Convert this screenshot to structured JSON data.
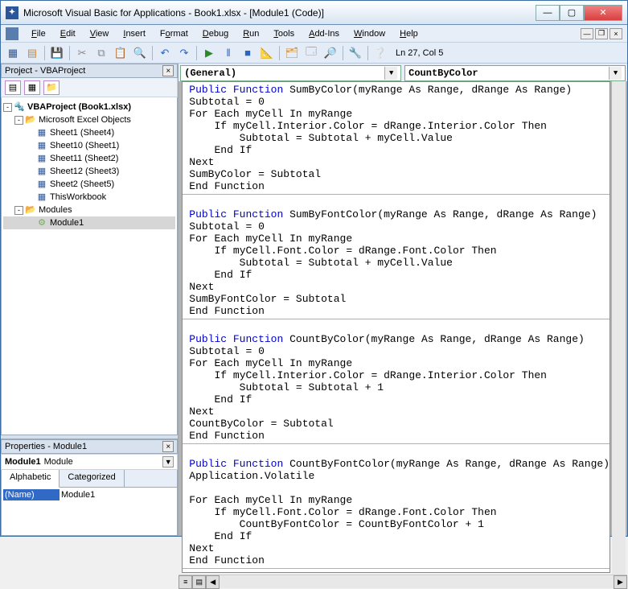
{
  "titlebar": {
    "text": "Microsoft Visual Basic for Applications - Book1.xlsx - [Module1 (Code)]"
  },
  "menubar": {
    "items": [
      {
        "label": "File",
        "accel": "F"
      },
      {
        "label": "Edit",
        "accel": "E"
      },
      {
        "label": "View",
        "accel": "V"
      },
      {
        "label": "Insert",
        "accel": "I"
      },
      {
        "label": "Format",
        "accel": "o"
      },
      {
        "label": "Debug",
        "accel": "D"
      },
      {
        "label": "Run",
        "accel": "R"
      },
      {
        "label": "Tools",
        "accel": "T"
      },
      {
        "label": "Add-Ins",
        "accel": "A"
      },
      {
        "label": "Window",
        "accel": "W"
      },
      {
        "label": "Help",
        "accel": "H"
      }
    ]
  },
  "toolbar": {
    "status": "Ln 27, Col 5"
  },
  "project_panel": {
    "title": "Project - VBAProject",
    "root": "VBAProject (Book1.xlsx)",
    "excel_folder": "Microsoft Excel Objects",
    "sheets": [
      "Sheet1 (Sheet4)",
      "Sheet10 (Sheet1)",
      "Sheet11 (Sheet2)",
      "Sheet12 (Sheet3)",
      "Sheet2 (Sheet5)"
    ],
    "workbook": "ThisWorkbook",
    "modules_folder": "Modules",
    "modules": [
      "Module1"
    ]
  },
  "properties_panel": {
    "title": "Properties - Module1",
    "object_bold": "Module1",
    "object_type": "Module",
    "tabs": [
      "Alphabetic",
      "Categorized"
    ],
    "rows": [
      {
        "name": "(Name)",
        "value": "Module1"
      }
    ]
  },
  "code_header": {
    "left_combo": "(General)",
    "right_combo": "CountByColor"
  },
  "code": {
    "functions": [
      {
        "lines": [
          {
            "t": "decl",
            "sig": "SumByColor",
            "params": "(myRange <kw>As</kw> Range, dRange <kw>As</kw> Range)"
          },
          {
            "t": "plain",
            "txt": "Subtotal = 0"
          },
          {
            "t": "for",
            "txt": "<kw>For Each</kw> myCell <kw>In</kw> myRange"
          },
          {
            "t": "if",
            "txt": "    <kw>If</kw> myCell.Interior.Color = dRange.Interior.Color <kw>Then</kw>"
          },
          {
            "t": "plain",
            "txt": "        Subtotal = Subtotal + myCell.Value"
          },
          {
            "t": "endif",
            "txt": "    <kw>End If</kw>"
          },
          {
            "t": "next",
            "txt": "<kw>Next</kw>"
          },
          {
            "t": "plain",
            "txt": "SumByColor = Subtotal"
          },
          {
            "t": "endfn",
            "txt": "<kw>End Function</kw>"
          }
        ]
      },
      {
        "lines": [
          {
            "t": "decl",
            "sig": "SumByFontColor",
            "params": "(myRange <kw>As</kw> Range, dRange <kw>As</kw> Range)"
          },
          {
            "t": "plain",
            "txt": "Subtotal = 0"
          },
          {
            "t": "for",
            "txt": "<kw>For Each</kw> myCell <kw>In</kw> myRange"
          },
          {
            "t": "if",
            "txt": "    <kw>If</kw> myCell.Font.Color = dRange.Font.Color <kw>Then</kw>"
          },
          {
            "t": "plain",
            "txt": "        Subtotal = Subtotal + myCell.Value"
          },
          {
            "t": "endif",
            "txt": "    <kw>End If</kw>"
          },
          {
            "t": "next",
            "txt": "<kw>Next</kw>"
          },
          {
            "t": "plain",
            "txt": "SumByFontColor = Subtotal"
          },
          {
            "t": "endfn",
            "txt": "<kw>End Function</kw>"
          }
        ]
      },
      {
        "lines": [
          {
            "t": "decl",
            "sig": "CountByColor",
            "params": "(myRange <kw>As</kw> Range, dRange <kw>As</kw> Range)"
          },
          {
            "t": "plain",
            "txt": "Subtotal = 0"
          },
          {
            "t": "for",
            "txt": "<kw>For Each</kw> myCell <kw>In</kw> myRange"
          },
          {
            "t": "if",
            "txt": "    <kw>If</kw> myCell.Interior.Color = dRange.Interior.Color <kw>Then</kw>"
          },
          {
            "t": "plain",
            "txt": "        Subtotal = Subtotal + 1"
          },
          {
            "t": "endif",
            "txt": "    <kw>End If</kw>"
          },
          {
            "t": "next",
            "txt": "<kw>Next</kw>"
          },
          {
            "t": "plain",
            "txt": "CountByColor = Subtotal"
          },
          {
            "t": "endfn",
            "txt": "<kw>End Function</kw>"
          }
        ]
      },
      {
        "lines": [
          {
            "t": "decl",
            "sig": "CountByFontColor",
            "params": "(myRange <kw>As</kw> Range, dRange <kw>As</kw> Range)"
          },
          {
            "t": "plain",
            "txt": "Application.Volatile"
          },
          {
            "t": "blank",
            "txt": ""
          },
          {
            "t": "for",
            "txt": "<kw>For Each</kw> myCell <kw>In</kw> myRange"
          },
          {
            "t": "if",
            "txt": "    <kw>If</kw> myCell.Font.Color = dRange.Font.Color <kw>Then</kw>"
          },
          {
            "t": "plain",
            "txt": "        CountByFontColor = CountByFontColor + 1"
          },
          {
            "t": "endif",
            "txt": "    <kw>End If</kw>"
          },
          {
            "t": "next",
            "txt": "<kw>Next</kw>"
          },
          {
            "t": "endfn",
            "txt": "<kw>End Function</kw>"
          }
        ]
      }
    ]
  }
}
